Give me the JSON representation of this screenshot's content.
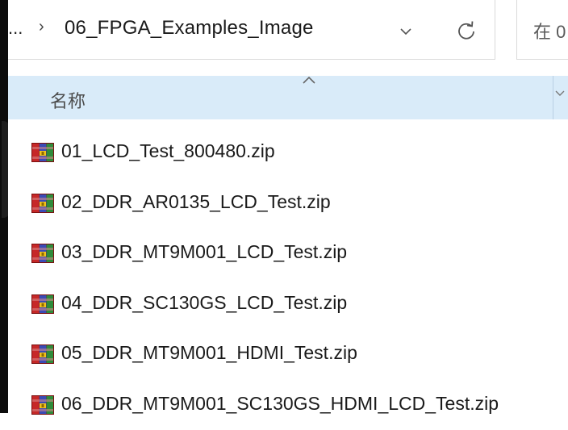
{
  "address_bar": {
    "ellipsis": "...",
    "separator": "›",
    "path": "06_FPGA_Examples_Image"
  },
  "search": {
    "text": "在 0"
  },
  "column_header": {
    "name": "名称"
  },
  "files": [
    {
      "name": "01_LCD_Test_800480.zip",
      "icon": "winrar-archive-icon"
    },
    {
      "name": "02_DDR_AR0135_LCD_Test.zip",
      "icon": "winrar-archive-icon"
    },
    {
      "name": "03_DDR_MT9M001_LCD_Test.zip",
      "icon": "winrar-archive-icon"
    },
    {
      "name": "04_DDR_SC130GS_LCD_Test.zip",
      "icon": "winrar-archive-icon"
    },
    {
      "name": "05_DDR_MT9M001_HDMI_Test.zip",
      "icon": "winrar-archive-icon"
    },
    {
      "name": "06_DDR_MT9M001_SC130GS_HDMI_LCD_Test.zip",
      "icon": "winrar-archive-icon"
    }
  ],
  "colors": {
    "header_bg": "#d9ebf9",
    "icon_red": "#c62828",
    "icon_blue": "#3a4bb5",
    "icon_green": "#2e8b3a",
    "icon_yellow": "#f2c21b"
  }
}
